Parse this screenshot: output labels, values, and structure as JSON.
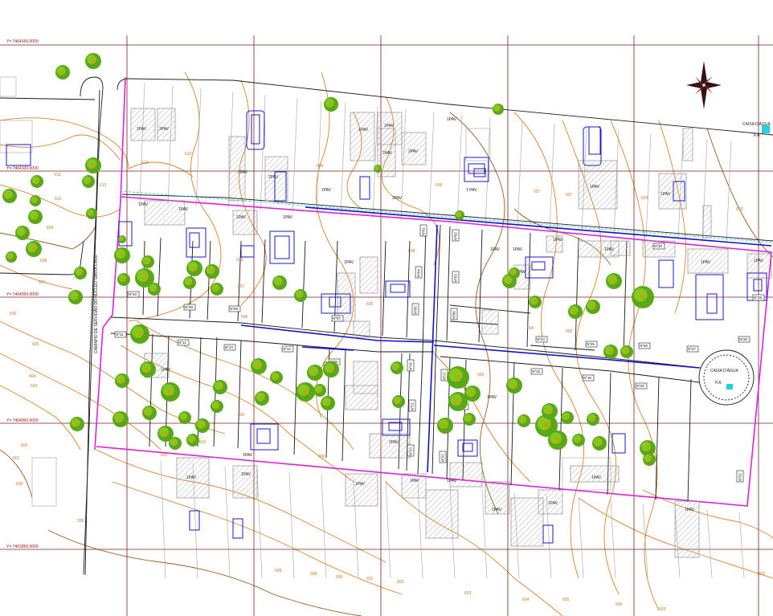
{
  "grid_labels": {
    "y1": "Y= 7464150.0000",
    "y2": "Y= 7464100.0000",
    "y3": "Y= 7464050.0000",
    "y4": "Y= 7464000.0000",
    "y5": "Y= 7463950.0000"
  },
  "street_name": "CAMINHO DE SERVIDÃO DO NÚCLEO SANTA CRUZ",
  "water_tank_top": "CAIXA D'ÁGUA",
  "water_tank_top_pa": "P.A.",
  "water_tank_right": "CAIXA D'ÁGUA",
  "water_tank_right_pa": "P.A.",
  "contour_labels": [
    "612",
    "613",
    "611",
    "610",
    "609",
    "608",
    "607",
    "606",
    "605",
    "604",
    "603",
    "602",
    "601",
    "600",
    "599",
    "598",
    "597"
  ],
  "building_labels": [
    "1PAV",
    "2PAV",
    "1 PAV"
  ],
  "lot_tags": [
    "Nº01",
    "Nº02",
    "Nº03",
    "Nº04",
    "Nº05",
    "Nº06",
    "Nº07",
    "Nº08",
    "Nº09",
    "Nº10",
    "Nº11",
    "Nº12",
    "Nº13",
    "Nº14",
    "Nº15",
    "Nº16",
    "Nº17",
    "Nº18",
    "Nº19",
    "Nº20",
    "Nº21",
    "Nº22",
    "Nº23",
    "Nº24",
    "Nº25",
    "Nº26",
    "Nº27",
    "Nº28",
    "Nº29",
    "Nº30",
    "Nº31",
    "Nº32",
    "Nº33"
  ],
  "colors": {
    "grid": "#7a1f1f",
    "contour": "#d8842a",
    "boundary": "#e020d8",
    "pipe": "#1010d0",
    "building": "#1a1acc",
    "tree": "#5aa818",
    "water_tank": "#25d0e0"
  },
  "icons": {
    "compass": "north-arrow-compass-rose-icon"
  }
}
